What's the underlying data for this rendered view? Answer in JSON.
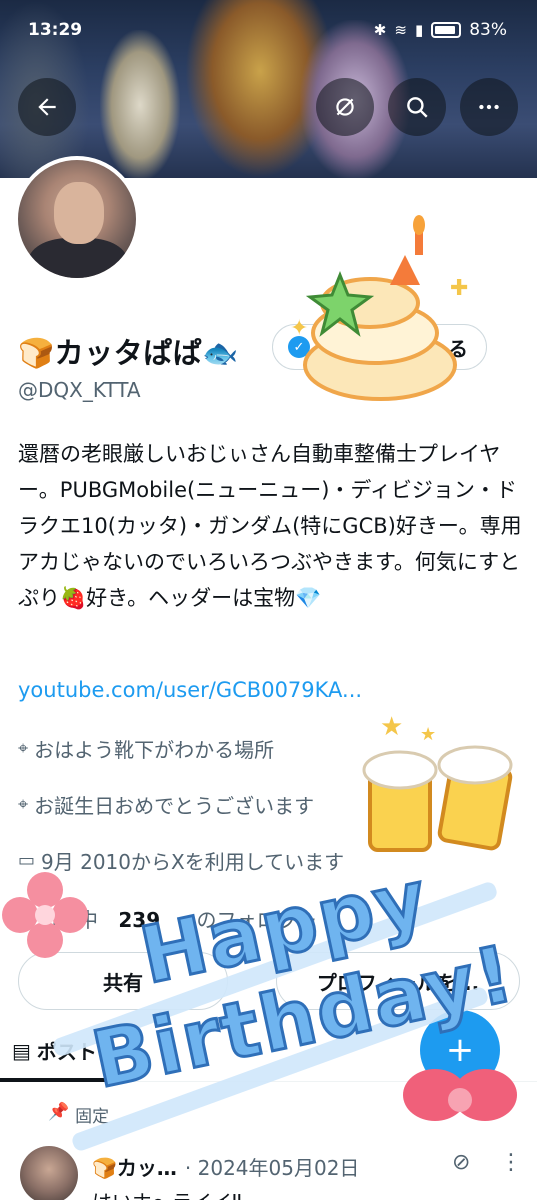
{
  "status_bar": {
    "time": "13:29",
    "battery": "83%"
  },
  "top_nav": {
    "back_icon": "arrow-left-icon",
    "repost_icon": "retweet-icon",
    "search_icon": "search-icon",
    "more_icon": "more-horizontal-icon"
  },
  "profile": {
    "name": "🍞カッタぱぱ🐟",
    "handle": "@DQX_KTTA",
    "follow_button_partial": "る",
    "bio": "還暦の老眼厳しいおじぃさん自動車整備士プレイヤー。PUBGMobile(ニューニュー)・ディビジョン・ドラクエ10(カッタ)・ガンダム(特にGCB)好きー。専用アカじゃないのでいろいろつぶやきます。何気にすとぷり🍓好き。ヘッダーは宝物💎",
    "link": "youtube.com/user/GCB0079KA...",
    "location": "おはよう靴下がわかる場所",
    "birthday": "お誕生日おめでとうございます",
    "joined": "9月 2010からXを利用しています",
    "following_label_partial": "ォロー中",
    "following_count": "239",
    "followers_label_partial": "のフォロワー"
  },
  "actions": {
    "left_pill": "共有",
    "right_pill": "プロフィールを..."
  },
  "tabs": {
    "posts": "ポスト"
  },
  "tweet": {
    "pinned_label": "固定",
    "author": "🍞カッ…",
    "date": "· 2024年05月02日",
    "body": "はいホ～ライイ‼"
  },
  "sticker": {
    "text_line1": "Happy",
    "text_line2": "Birthday!"
  },
  "colors": {
    "link": "#1d9bf0",
    "secondary_text": "#536471",
    "sticker_blue": "#6fb4ef"
  }
}
